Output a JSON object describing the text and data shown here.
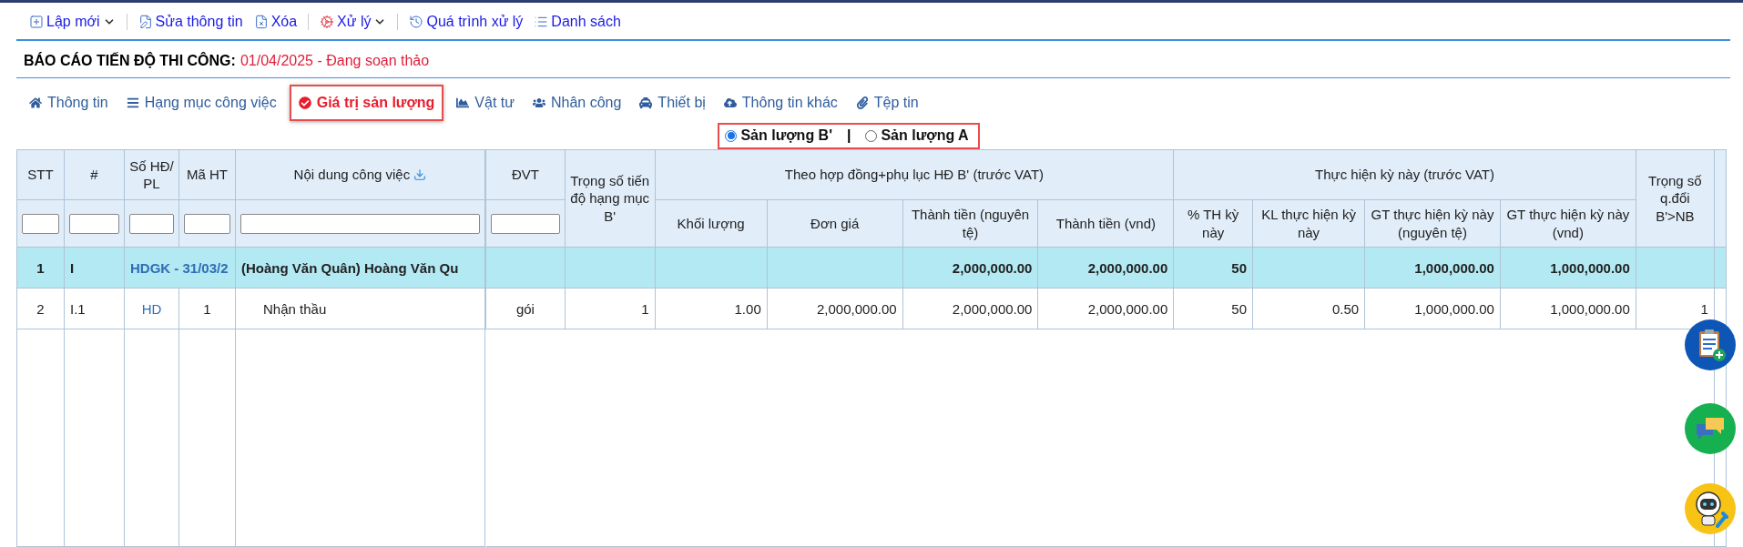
{
  "toolbar": [
    {
      "label": "Lập mới",
      "dropdown": true
    },
    {
      "label": "Sửa thông tin",
      "dropdown": false
    },
    {
      "label": "Xóa",
      "dropdown": false
    },
    {
      "label": "Xử lý",
      "dropdown": true
    },
    {
      "label": "Quá trình xử lý",
      "dropdown": false
    },
    {
      "label": "Danh sách",
      "dropdown": false
    }
  ],
  "title": {
    "label": "BÁO CÁO TIẾN ĐỘ THI CÔNG:",
    "value": "01/04/2025 - Đang soạn thảo"
  },
  "tabs": [
    {
      "label": "Thông tin",
      "selected": false
    },
    {
      "label": "Hạng mục công việc",
      "selected": false
    },
    {
      "label": "Giá trị sản lượng",
      "selected": true
    },
    {
      "label": "Vật tư",
      "selected": false
    },
    {
      "label": "Nhân công",
      "selected": false
    },
    {
      "label": "Thiết bị",
      "selected": false
    },
    {
      "label": "Thông tin khác",
      "selected": false
    },
    {
      "label": "Tệp tin",
      "selected": false
    }
  ],
  "radio": {
    "options": [
      {
        "label": "Sản lượng B'",
        "selected": true
      },
      {
        "label": "Sản lượng A",
        "selected": false
      }
    ],
    "separator": "|"
  },
  "table": {
    "left_columns": [
      {
        "label": "STT",
        "kind": "plain"
      },
      {
        "label": "#",
        "kind": "plain"
      },
      {
        "label": "Số HĐ/ PL",
        "kind": "link"
      },
      {
        "label": "Mã HT",
        "kind": "plain"
      },
      {
        "label": "Nội dung công việc",
        "kind": "download"
      }
    ],
    "groups": [
      {
        "label": "Theo hợp đồng+phụ lục HĐ B' (trước VAT)"
      },
      {
        "label": "Thực hiện kỳ này (trước VAT)"
      }
    ],
    "right_columns": [
      {
        "label": "ĐVT",
        "kind": "filter"
      },
      {
        "label": "Trọng số tiến độ hạng mục B'",
        "kind": "tall"
      },
      {
        "label": "Khối lượng",
        "kind": "group0"
      },
      {
        "label": "Đơn giá",
        "kind": "group0"
      },
      {
        "label": "Thành tiền (nguyên tệ)",
        "kind": "group0"
      },
      {
        "label": "Thành tiền (vnd)",
        "kind": "group0"
      },
      {
        "label": "% TH kỳ này",
        "kind": "group1"
      },
      {
        "label": "KL thực hiện kỳ này",
        "kind": "group1"
      },
      {
        "label": "GT thực hiện kỳ này (nguyên tệ)",
        "kind": "group1"
      },
      {
        "label": "GT thực hiện kỳ này (vnd)",
        "kind": "group1"
      },
      {
        "label": "Trọng số q.đổi B'>NB",
        "kind": "tall"
      }
    ],
    "rows": [
      {
        "kind": "group",
        "left": [
          {
            "kind": "text",
            "text": "1"
          },
          {
            "kind": "text",
            "text": "I"
          },
          {
            "kind": "text",
            "text": "HDGK - 31/03/2"
          },
          {
            "kind": "blank"
          },
          {
            "kind": "text",
            "text": "(Hoàng Văn Quân) Hoàng Văn Qu"
          }
        ],
        "right": [
          {
            "kind": "blank"
          },
          {
            "kind": "blank"
          },
          {
            "kind": "blank"
          },
          {
            "kind": "blank"
          },
          {
            "kind": "text",
            "text": "2,000,000.00"
          },
          {
            "kind": "text",
            "text": "2,000,000.00"
          },
          {
            "kind": "text",
            "text": "50"
          },
          {
            "kind": "blank"
          },
          {
            "kind": "text",
            "text": "1,000,000.00"
          },
          {
            "kind": "text",
            "text": "1,000,000.00"
          },
          {
            "kind": "blank"
          }
        ]
      },
      {
        "kind": "item",
        "left": [
          {
            "kind": "text",
            "text": "2"
          },
          {
            "kind": "text",
            "text": "I.1"
          },
          {
            "kind": "text",
            "text": "HD"
          },
          {
            "kind": "text",
            "text": "1"
          },
          {
            "kind": "text",
            "text": "Nhận thầu"
          }
        ],
        "right": [
          {
            "kind": "text",
            "text": "gói"
          },
          {
            "kind": "text",
            "text": "1"
          },
          {
            "kind": "text",
            "text": "1.00"
          },
          {
            "kind": "text",
            "text": "2,000,000.00"
          },
          {
            "kind": "text",
            "text": "2,000,000.00"
          },
          {
            "kind": "text",
            "text": "2,000,000.00"
          },
          {
            "kind": "text",
            "text": "50"
          },
          {
            "kind": "text",
            "text": "0.50"
          },
          {
            "kind": "text",
            "text": "1,000,000.00"
          },
          {
            "kind": "text",
            "text": "1,000,000.00"
          },
          {
            "kind": "text",
            "text": "1"
          }
        ]
      }
    ]
  }
}
